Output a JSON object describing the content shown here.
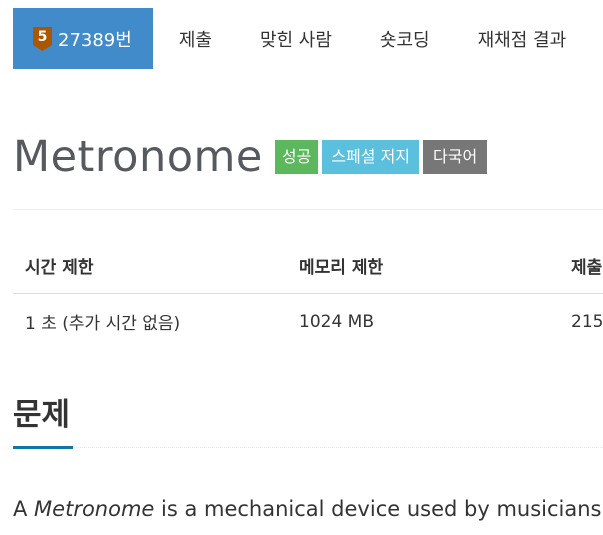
{
  "nav": {
    "problem_tab": {
      "level": "5",
      "label": "27389번"
    },
    "tabs": [
      {
        "label": "제출"
      },
      {
        "label": "맞힌 사람"
      },
      {
        "label": "숏코딩"
      },
      {
        "label": "재채점 결과"
      }
    ]
  },
  "problem": {
    "title": "Metronome",
    "labels": [
      "성공",
      "스페셜 저지",
      "다국어"
    ]
  },
  "limits": {
    "headers": [
      "시간 제한",
      "메모리 제한",
      "제출"
    ],
    "values": [
      "1 초 (추가 시간 없음)",
      "1024 MB",
      "215"
    ]
  },
  "section": {
    "title": "문제"
  },
  "description": {
    "prefix": "A ",
    "emphasis": "Metronome",
    "suffix": " is a mechanical device used by musicians"
  },
  "colors": {
    "active_tab": "#428bca",
    "level_badge": "#ad5600",
    "label_success": "#5cb85c",
    "label_info": "#5bc0de",
    "label_default": "#777777",
    "section_accent": "#0e76a8"
  }
}
